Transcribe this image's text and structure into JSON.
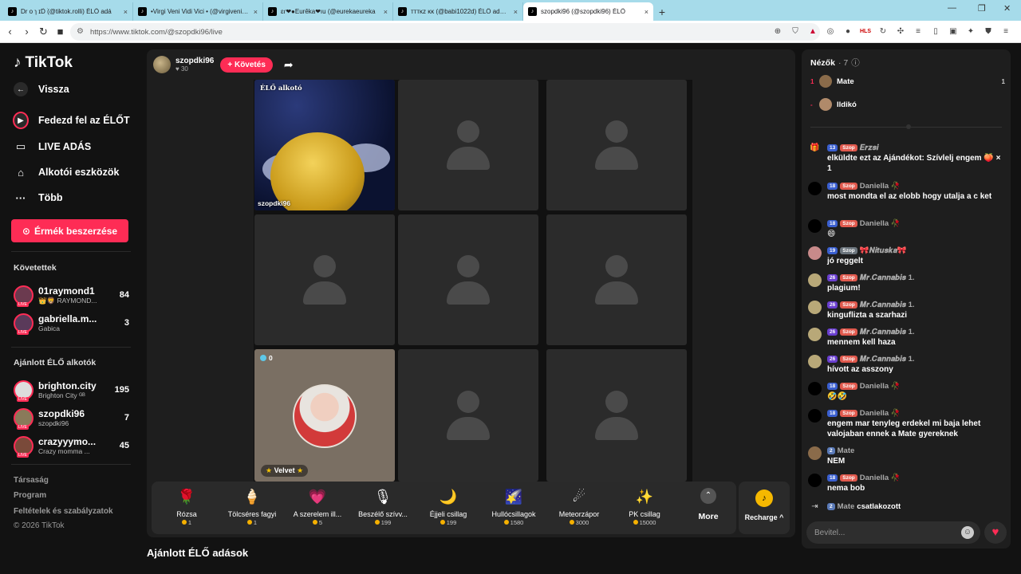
{
  "browser": {
    "tabs": [
      {
        "title": "Dr o ɿ ɪD͡ (@tiktok.rolli) ÉLŐ adá"
      },
      {
        "title": "•Virgi Veni Vidi Vici • (@virgivenividi"
      },
      {
        "title": "ɛɾ❤●Eurêka❤ıu (@eurekaeureka"
      },
      {
        "title": "ᴛᴛᴛᴋᴢ ᴋᴋ (@babi1022d) ÉLŐ adásba"
      },
      {
        "title": "szopdki96 (@szopdki96) ÉLŐ"
      }
    ],
    "url": "https://www.tiktok.com/@szopdki96/live"
  },
  "sidebar": {
    "logo": "TikTok",
    "back": "Vissza",
    "nav": [
      {
        "label": "Fedezd fel az ÉLŐT",
        "icon": "live-explore-icon"
      },
      {
        "label": "LIVE ADÁS",
        "icon": "video-camera-icon"
      },
      {
        "label": "Alkotói eszközök",
        "icon": "home-icon"
      },
      {
        "label": "Több",
        "icon": "more-dots-icon"
      }
    ],
    "coins_button": "Érmék beszerzése",
    "following_head": "Követettek",
    "following": [
      {
        "name": "01raymond1",
        "sub": "👑🦁 RAYMOND...",
        "count": "84"
      },
      {
        "name": "gabriella.m...",
        "sub": "Gabica",
        "count": "3"
      }
    ],
    "recommended_head": "Ajánlott ÉLŐ alkotók",
    "recommended": [
      {
        "name": "brighton.city",
        "sub": "Brighton City ᴳᴮ",
        "count": "195"
      },
      {
        "name": "szopdki96",
        "sub": "szopdki96",
        "count": "7"
      },
      {
        "name": "crazyyymo...",
        "sub": "Crazy momma ...",
        "count": "45"
      }
    ],
    "footer": [
      "Társaság",
      "Program",
      "Feltételek és szabályzatok",
      "© 2026 TikTok"
    ]
  },
  "stage": {
    "host_name": "szopdki96",
    "host_likes": "30",
    "follow_label": "+ Követés",
    "live_label": "ÉLŐ alkotó",
    "host_cell_name": "szopdki96",
    "guest_count": "0",
    "guest_name": "Velvet",
    "gifts": [
      {
        "label": "Rózsa",
        "price": "1",
        "icon": "🌹"
      },
      {
        "label": "Tölcséres fagyi",
        "price": "1",
        "icon": "🍦"
      },
      {
        "label": "A szerelem ill...",
        "price": "5",
        "icon": "💗"
      },
      {
        "label": "Beszélő szívv...",
        "price": "199",
        "icon": "🎙"
      },
      {
        "label": "Éjjeli csillag",
        "price": "199",
        "icon": "🌙"
      },
      {
        "label": "Hullócsillagok",
        "price": "1580",
        "icon": "🌠"
      },
      {
        "label": "Meteorzápor",
        "price": "3000",
        "icon": "☄"
      },
      {
        "label": "PK csillag",
        "price": "15000",
        "icon": "✨"
      }
    ],
    "more_label": "More",
    "recharge_label": "Recharge ^"
  },
  "recommended_section": "Ajánlott ÉLŐ adások",
  "chat": {
    "viewers_label": "Nézők",
    "viewers_count": "· 7",
    "viewers": [
      {
        "rank": "1",
        "name": "Mate",
        "score": "1"
      },
      {
        "rank": "-",
        "name": "Ildikó",
        "score": ""
      }
    ],
    "messages": [
      {
        "level": "13",
        "badge": "Szop",
        "user": "𝑬𝒓𝒛𝒔𝒊",
        "text": "elküldte ezt az Ajándékot: Szívlelj engem 🍑 × 1"
      },
      {
        "level": "18",
        "badge": "Szop",
        "user": "Daniella 🥀",
        "text": "most mondta el az elobb hogy utalja a c ket"
      },
      {
        "level": "18",
        "badge": "Szop",
        "user": "Daniella 🥀",
        "text": "😄"
      },
      {
        "level": "19",
        "badge": "Szop",
        "user": "🎀𝑵𝒊𝒕𝒖𝒔𝒌𝒂🎀",
        "text": "jó reggelt"
      },
      {
        "level": "26",
        "badge": "Szop",
        "user": "𝑴𝒓.𝑪𝒂𝒏𝒏𝒂𝒃𝒊𝒔 1.",
        "text": "plagium!"
      },
      {
        "level": "26",
        "badge": "Szop",
        "user": "𝑴𝒓.𝑪𝒂𝒏𝒏𝒂𝒃𝒊𝒔 1.",
        "text": "kinguflizta a szarhazi"
      },
      {
        "level": "26",
        "badge": "Szop",
        "user": "𝑴𝒓.𝑪𝒂𝒏𝒏𝒂𝒃𝒊𝒔 1.",
        "text": "mennem kell haza"
      },
      {
        "level": "26",
        "badge": "Szop",
        "user": "𝑴𝒓.𝑪𝒂𝒏𝒏𝒂𝒃𝒊𝒔 1.",
        "text": "hívott az asszony"
      },
      {
        "level": "18",
        "badge": "Szop",
        "user": "Daniella 🥀",
        "text": "🤣🤣"
      },
      {
        "level": "18",
        "badge": "Szop",
        "user": "Daniella 🥀",
        "text": "engem mar tenyleg erdekel mi baja lehet valojaban ennek a Mate gyereknek"
      },
      {
        "level": "2",
        "badge": "",
        "user": "Mate",
        "text": "NEM"
      },
      {
        "level": "18",
        "badge": "Szop",
        "user": "Daniella 🥀",
        "text": "nema bob"
      }
    ],
    "join": {
      "level": "2",
      "user": "Mate",
      "text": "csatlakozott"
    },
    "input_placeholder": "Bevitel..."
  },
  "colors": {
    "accent": "#fe2c55",
    "tabbar": "#a6dbea"
  }
}
